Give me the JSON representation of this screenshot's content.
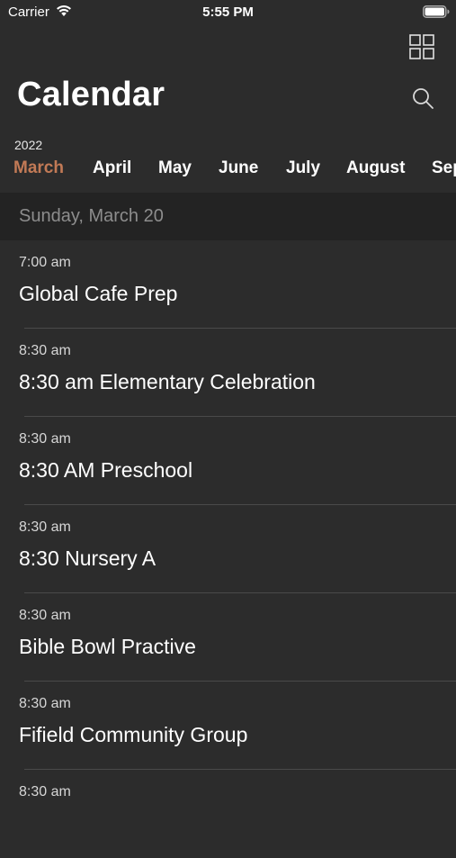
{
  "status_bar": {
    "carrier": "Carrier",
    "time": "5:55 PM"
  },
  "header": {
    "title": "Calendar",
    "grid_icon": "grid-icon",
    "search_icon": "search-icon"
  },
  "month_strip": {
    "year": "2022",
    "months": [
      {
        "label": "March",
        "selected": true
      },
      {
        "label": "April"
      },
      {
        "label": "May"
      },
      {
        "label": "June"
      },
      {
        "label": "July"
      },
      {
        "label": "August"
      },
      {
        "label": "Sep"
      }
    ]
  },
  "date_header": "Sunday, March 20",
  "events": [
    {
      "time": "7:00 am",
      "title": "Global Cafe Prep"
    },
    {
      "time": "8:30 am",
      "title": "8:30 am Elementary Celebration"
    },
    {
      "time": "8:30 am",
      "title": "8:30 AM Preschool"
    },
    {
      "time": "8:30 am",
      "title": "8:30 Nursery A"
    },
    {
      "time": "8:30 am",
      "title": "Bible Bowl Practive"
    },
    {
      "time": "8:30 am",
      "title": "Fifield Community Group"
    },
    {
      "time": "8:30 am",
      "title": ""
    }
  ],
  "colors": {
    "background": "#2c2c2c",
    "accent": "#c27a56",
    "date_header_bg": "#232323"
  }
}
